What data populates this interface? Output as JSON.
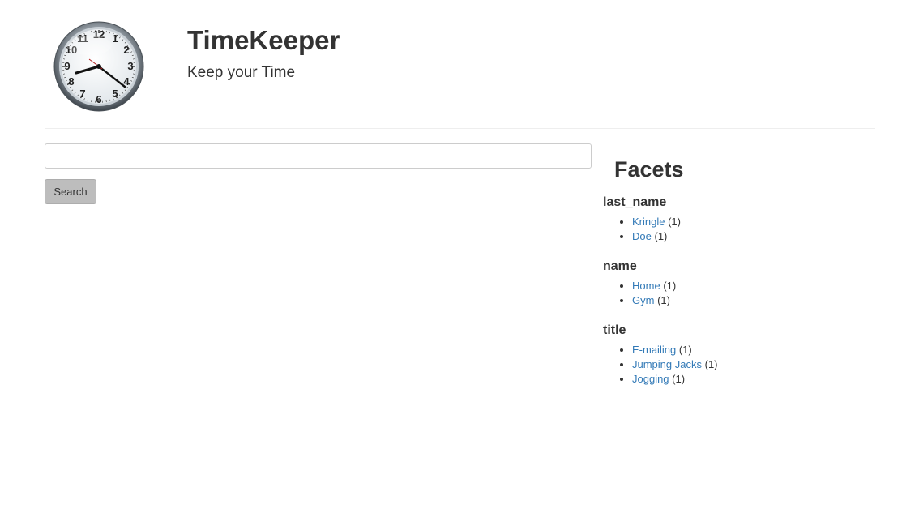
{
  "header": {
    "title": "TimeKeeper",
    "tagline": "Keep your Time",
    "logo_icon": "analog-clock-icon"
  },
  "search": {
    "value": "",
    "placeholder": "",
    "button_label": "Search"
  },
  "facets": {
    "heading": "Facets",
    "groups": [
      {
        "title": "last_name",
        "items": [
          {
            "label": "Kringle",
            "count": "(1)"
          },
          {
            "label": "Doe",
            "count": "(1)"
          }
        ]
      },
      {
        "title": "name",
        "items": [
          {
            "label": "Home",
            "count": "(1)"
          },
          {
            "label": "Gym",
            "count": "(1)"
          }
        ]
      },
      {
        "title": "title",
        "items": [
          {
            "label": "E-mailing",
            "count": "(1)"
          },
          {
            "label": "Jumping Jacks",
            "count": "(1)"
          },
          {
            "label": "Jogging",
            "count": "(1)"
          }
        ]
      }
    ]
  },
  "colors": {
    "link": "#337ab7",
    "text": "#333333",
    "button_bg": "#bdbdbd"
  }
}
